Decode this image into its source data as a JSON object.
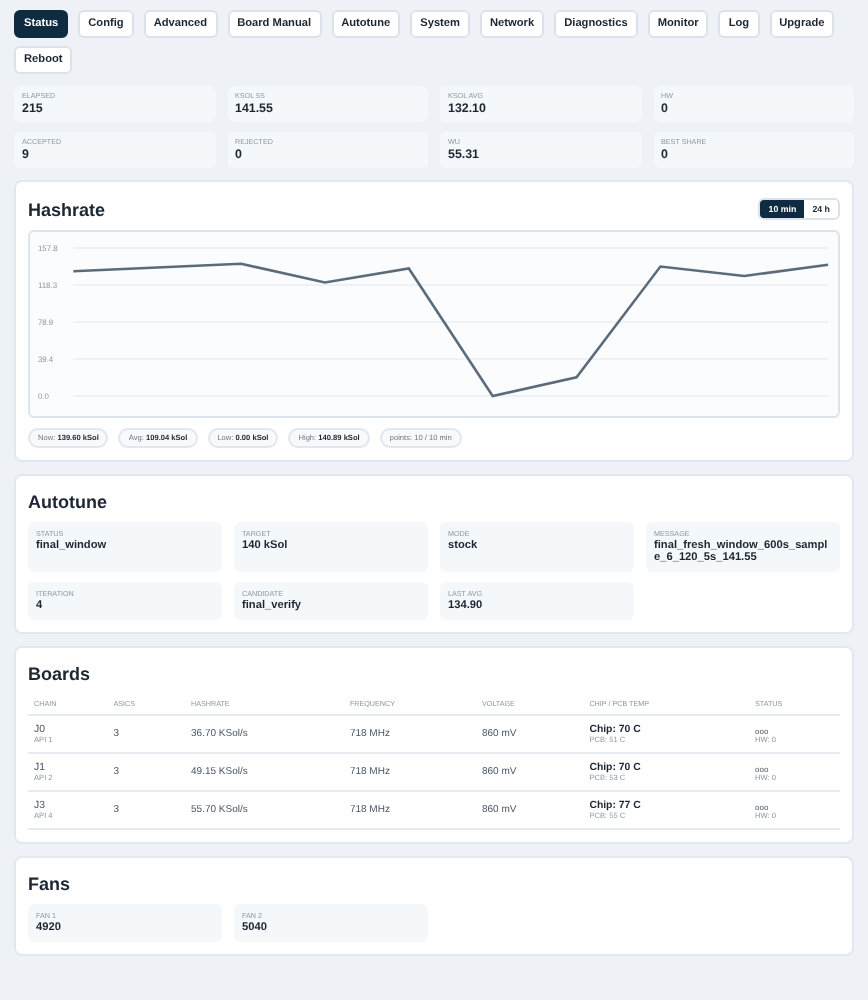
{
  "tabs": [
    {
      "label": "Status",
      "selected": true
    },
    {
      "label": "Config",
      "selected": false
    },
    {
      "label": "Advanced",
      "selected": false
    },
    {
      "label": "Board Manual",
      "selected": false
    },
    {
      "label": "Autotune",
      "selected": false
    },
    {
      "label": "System",
      "selected": false
    },
    {
      "label": "Network",
      "selected": false
    },
    {
      "label": "Diagnostics",
      "selected": false
    },
    {
      "label": "Monitor",
      "selected": false
    },
    {
      "label": "Log",
      "selected": false
    },
    {
      "label": "Upgrade",
      "selected": false
    },
    {
      "label": "Reboot",
      "selected": false
    }
  ],
  "stats": [
    {
      "label": "ELAPSED",
      "value": "215"
    },
    {
      "label": "KSOL 5S",
      "value": "141.55"
    },
    {
      "label": "KSOL AVG",
      "value": "132.10"
    },
    {
      "label": "HW",
      "value": "0"
    },
    {
      "label": "ACCEPTED",
      "value": "9"
    },
    {
      "label": "REJECTED",
      "value": "0"
    },
    {
      "label": "WU",
      "value": "55.31"
    },
    {
      "label": "BEST SHARE",
      "value": "0"
    }
  ],
  "hashrate": {
    "title": "Hashrate",
    "ranges": [
      {
        "label": "10 min",
        "selected": true
      },
      {
        "label": "24 h",
        "selected": false
      }
    ],
    "chart_data": {
      "type": "line",
      "grid": true,
      "series": [
        {
          "color": "#5b6b7a",
          "values": [
            133,
            137,
            141,
            121,
            136,
            0,
            20,
            138,
            128,
            140
          ]
        }
      ],
      "ylim": [
        0,
        157.8
      ],
      "yticks": [
        {
          "value": 157.8,
          "label": "157.8"
        },
        {
          "value": 118.35,
          "label": "118.3"
        },
        {
          "value": 78.9,
          "label": "78.9"
        },
        {
          "value": 39.45,
          "label": "39.4"
        },
        {
          "value": 0,
          "label": "0.0"
        }
      ]
    },
    "pills": [
      "Now: **139.60 kSol**",
      "Avg: **109.04 kSol**",
      "Low: **0.00 kSol**",
      "High: **140.89 kSol**",
      "points: 10 / 10 min"
    ]
  },
  "autotune": {
    "title": "Autotune",
    "fields": [
      {
        "label": "STATUS",
        "value": "final_window"
      },
      {
        "label": "TARGET",
        "value": "140 kSol"
      },
      {
        "label": "MODE",
        "value": "stock"
      },
      {
        "label": "MESSAGE",
        "value": "final_fresh_window_600s_sample_6_120_5s_141.55"
      },
      {
        "label": "ITERATION",
        "value": "4"
      },
      {
        "label": "CANDIDATE",
        "value": "final_verify"
      },
      {
        "label": "LAST AVG",
        "value": "134.90"
      }
    ]
  },
  "boards": {
    "title": "Boards",
    "columns": [
      "CHAIN",
      "ASICS",
      "HASHRATE",
      "FREQUENCY",
      "VOLTAGE",
      "CHIP / PCB TEMP",
      "STATUS"
    ],
    "rows": [
      {
        "chain": "J0",
        "api": "API 1",
        "asics": "3",
        "hashrate": "36.70 KSol/s",
        "frequency": "718 MHz",
        "voltage": "860 mV",
        "chip": "Chip: 70 C",
        "pcb": "PCB: 51 C",
        "status": "ooo",
        "hw": "HW: 0"
      },
      {
        "chain": "J1",
        "api": "API 2",
        "asics": "3",
        "hashrate": "49.15 KSol/s",
        "frequency": "718 MHz",
        "voltage": "860 mV",
        "chip": "Chip: 70 C",
        "pcb": "PCB: 53 C",
        "status": "ooo",
        "hw": "HW: 0"
      },
      {
        "chain": "J3",
        "api": "API 4",
        "asics": "3",
        "hashrate": "55.70 KSol/s",
        "frequency": "718 MHz",
        "voltage": "860 mV",
        "chip": "Chip: 77 C",
        "pcb": "PCB: 55 C",
        "status": "ooo",
        "hw": "HW: 0"
      }
    ]
  },
  "fans": {
    "title": "Fans",
    "items": [
      {
        "label": "FAN 1",
        "value": "4920"
      },
      {
        "label": "FAN 2",
        "value": "5040"
      }
    ]
  }
}
